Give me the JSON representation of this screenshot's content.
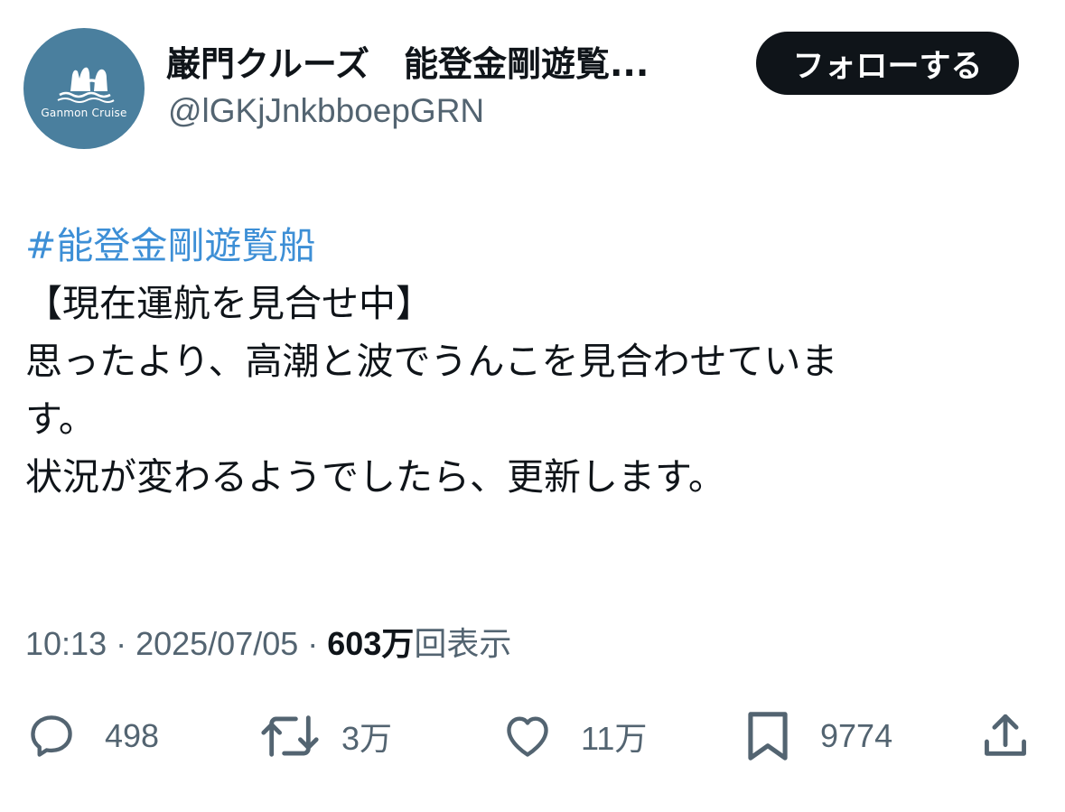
{
  "account": {
    "avatar_label": "Ganmon Cruise",
    "display_name": "巌門クルーズ　能登金剛遊覧...",
    "handle": "@lGKjJnkbboepGRN",
    "follow_label": "フォローする"
  },
  "tweet": {
    "hashtag": "#能登金剛遊覧船",
    "lines": [
      "【現在運航を見合せ中】",
      "思ったより、高潮と波でうんこを見合わせていま",
      "す。",
      "状況が変わるようでしたら、更新します。"
    ]
  },
  "meta": {
    "time": "10:13",
    "separator": " · ",
    "date": "2025/07/05",
    "views_count": "603万",
    "views_label": "回表示"
  },
  "actions": {
    "reply": {
      "icon": "speech-bubble-icon",
      "count": "498"
    },
    "repost": {
      "icon": "repost-icon",
      "count": "3万"
    },
    "like": {
      "icon": "heart-icon",
      "count": "11万"
    },
    "bookmark": {
      "icon": "bookmark-icon",
      "count": "9774"
    },
    "share": {
      "icon": "share-icon"
    }
  },
  "colors": {
    "avatar_bg": "#4a7f9e",
    "hashtag": "#3d8fd6",
    "secondary_text": "#536471",
    "button_bg": "#0f1419"
  }
}
